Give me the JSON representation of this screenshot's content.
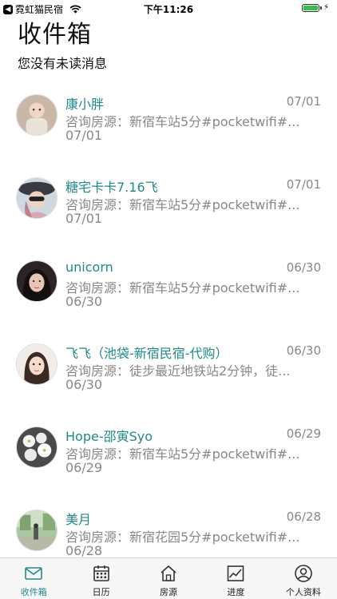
{
  "status_bar": {
    "carrier": "霓虹猫民宿",
    "time": "下午11:26",
    "battery_level": 1.0
  },
  "header": {
    "title": "收件箱",
    "subtitle": "您没有未读消息"
  },
  "conversations": [
    {
      "name": "康小胖",
      "date": "07/01",
      "preview": "咨询房源：新宿车站5分#pocketwifi#...",
      "sub_date": "07/01",
      "avatar": "avatar-baby-photo"
    },
    {
      "name": "糖宅卡卡7.16飞",
      "date": "07/01",
      "preview": "咨询房源：新宿车站5分#pocketwifi#...",
      "sub_date": "07/01",
      "avatar": "avatar-woman-hat-photo"
    },
    {
      "name": "unicorn",
      "date": "06/30",
      "preview": "咨询房源：新宿车站5分#pocketwifi#...",
      "sub_date": "06/30",
      "avatar": "avatar-woman-dark-photo"
    },
    {
      "name": "飞飞（池袋-新宿民宿-代购）",
      "date": "06/30",
      "preview": "咨询房源：徒步最近地铁站2分钟，徒...",
      "sub_date": "06/30",
      "avatar": "avatar-woman-photo"
    },
    {
      "name": "Hope-邵寅Syo",
      "date": "06/29",
      "preview": "咨询房源：新宿车站5分#pocketwifi#...",
      "sub_date": "06/29",
      "avatar": "avatar-flowers-photo"
    },
    {
      "name": "美月",
      "date": "06/28",
      "preview": "咨询房源：新宿花园5分#pocketwifi#...",
      "sub_date": "06/28",
      "avatar": "avatar-outdoor-photo"
    }
  ],
  "tabs": [
    {
      "label": "收件箱",
      "icon": "inbox-icon",
      "active": true
    },
    {
      "label": "日历",
      "icon": "calendar-icon",
      "active": false
    },
    {
      "label": "房源",
      "icon": "house-icon",
      "active": false
    },
    {
      "label": "进度",
      "icon": "chart-icon",
      "active": false
    },
    {
      "label": "个人资料",
      "icon": "user-icon",
      "active": false
    }
  ],
  "colors": {
    "accent": "#1f8a8a",
    "muted_text": "#888888",
    "tab_bar_bg": "#f6f6f6",
    "battery": "#33c24d"
  }
}
